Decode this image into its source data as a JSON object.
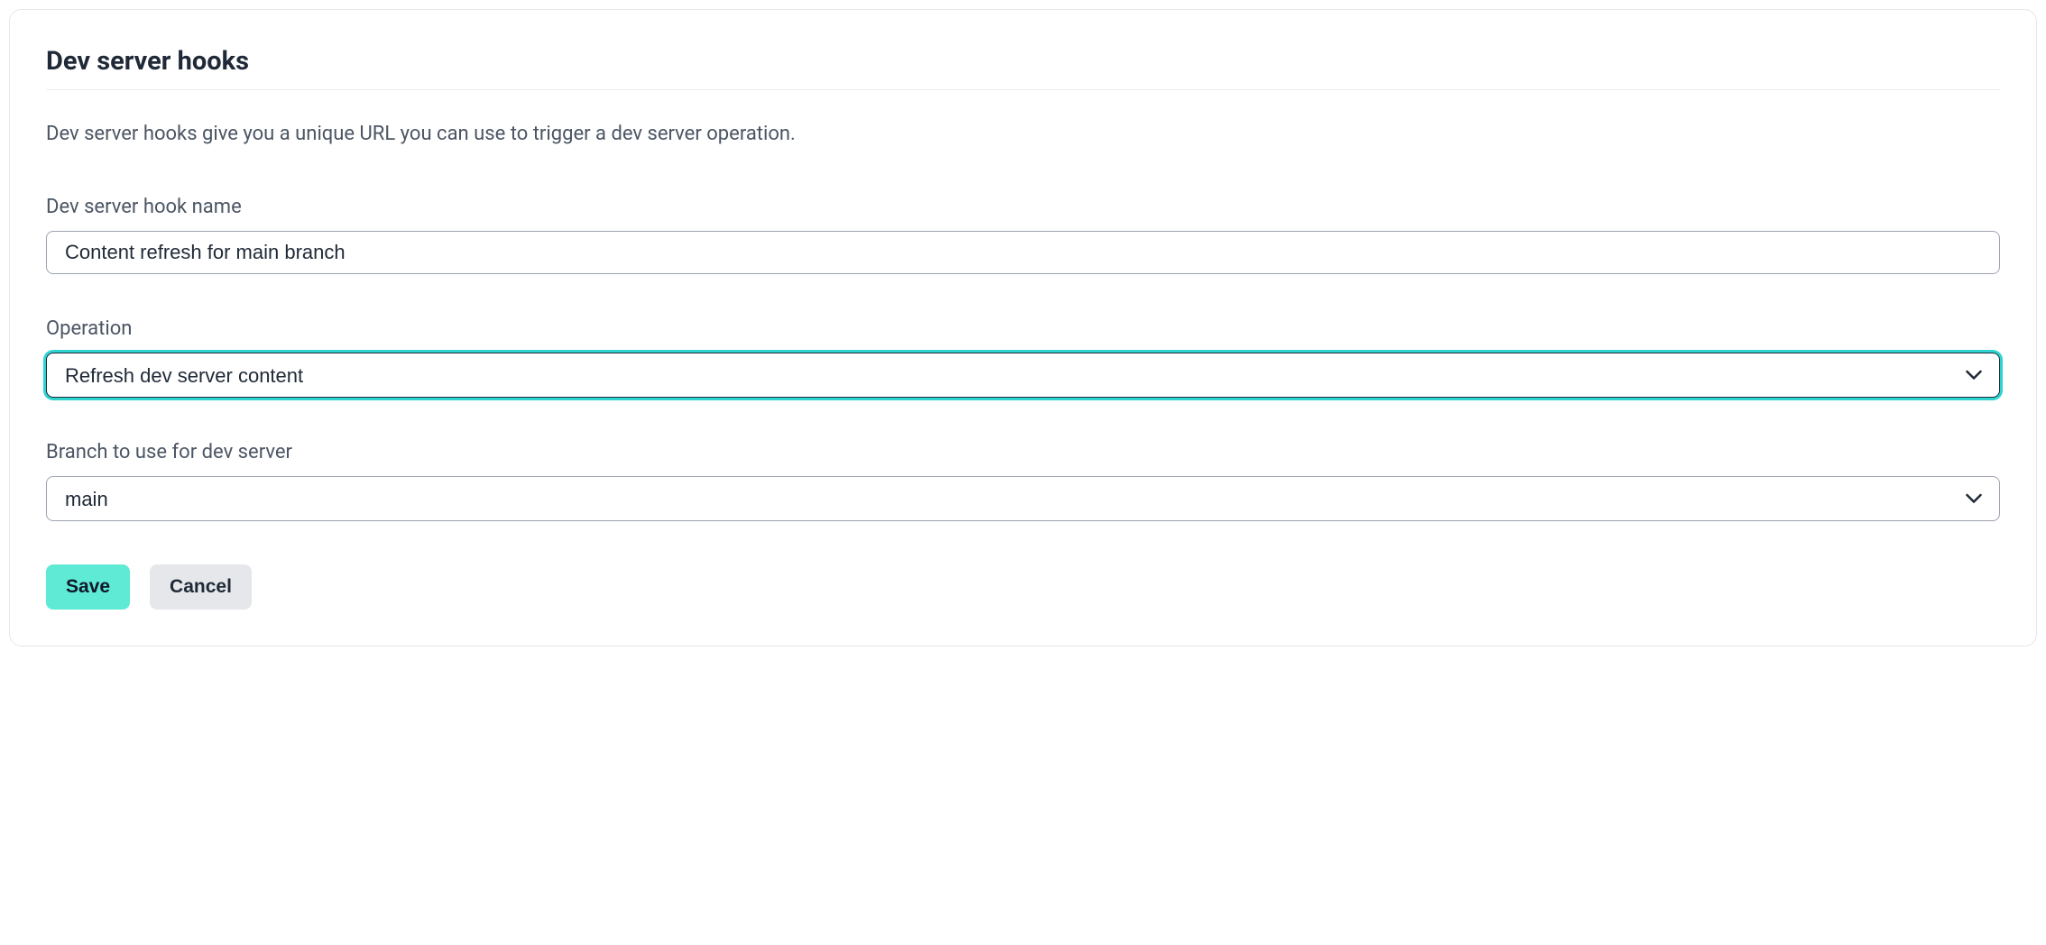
{
  "card": {
    "title": "Dev server hooks",
    "description": "Dev server hooks give you a unique URL you can use to trigger a dev server operation."
  },
  "fields": {
    "hookName": {
      "label": "Dev server hook name",
      "value": "Content refresh for main branch"
    },
    "operation": {
      "label": "Operation",
      "value": "Refresh dev server content"
    },
    "branch": {
      "label": "Branch to use for dev server",
      "value": "main"
    }
  },
  "buttons": {
    "save": "Save",
    "cancel": "Cancel"
  }
}
